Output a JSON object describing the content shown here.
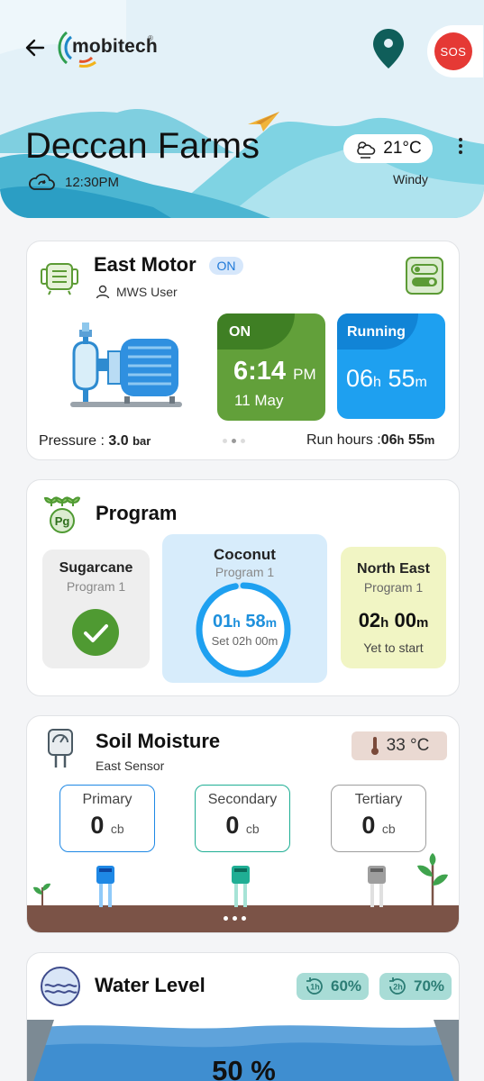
{
  "header": {
    "brand": "mobitech",
    "brand_mark": "®",
    "sos_label": "SOS",
    "farm_name": "Deccan Farms",
    "time": "12:30PM",
    "temperature": "21°C",
    "condition": "Windy"
  },
  "motor": {
    "title": "East Motor",
    "status_chip": "ON",
    "user": "MWS User",
    "on_tile": {
      "label": "ON",
      "time": "6:14",
      "ampm": "PM",
      "date": "11 May"
    },
    "run_tile": {
      "label": "Running",
      "hours": "06",
      "h_unit": "h",
      "minutes": "55",
      "m_unit": "m"
    },
    "pressure_label": "Pressure :",
    "pressure_value": "3.0",
    "pressure_unit": "bar",
    "run_hours_label": "Run hours :",
    "run_hours_h": "06",
    "run_hours_h_unit": "h",
    "run_hours_m": "55",
    "run_hours_m_unit": "m"
  },
  "program": {
    "title": "Program",
    "icon_text": "Pg",
    "items": [
      {
        "name": "Sugarcane",
        "sub": "Program 1",
        "state": "completed"
      },
      {
        "name": "Coconut",
        "sub": "Program 1",
        "elapsed_h": "01",
        "elapsed_m": "58",
        "set_label": "Set 02h 00m",
        "progress": 0.97
      },
      {
        "name": "North East",
        "sub": "Program 1",
        "time_h": "02",
        "time_m": "00",
        "status": "Yet to start"
      }
    ],
    "h_unit": "h",
    "m_unit": "m"
  },
  "soil": {
    "title": "Soil Moisture",
    "sensor": "East Sensor",
    "temperature": "33 °C",
    "unit": "cb",
    "sensors": [
      {
        "label": "Primary",
        "value": "0",
        "color": "#1e88e5"
      },
      {
        "label": "Secondary",
        "value": "0",
        "color": "#1fae94"
      },
      {
        "label": "Tertiary",
        "value": "0",
        "color": "#9e9e9e"
      }
    ]
  },
  "water": {
    "title": "Water Level",
    "chips": [
      {
        "icon": "1h",
        "value": "60%"
      },
      {
        "icon": "2h",
        "value": "70%"
      }
    ],
    "level": "50 %"
  },
  "colors": {
    "accent_blue": "#1ea0f0",
    "on_green": "#62a03a",
    "sos_red": "#e53935",
    "soil_brown": "#7b5347"
  }
}
